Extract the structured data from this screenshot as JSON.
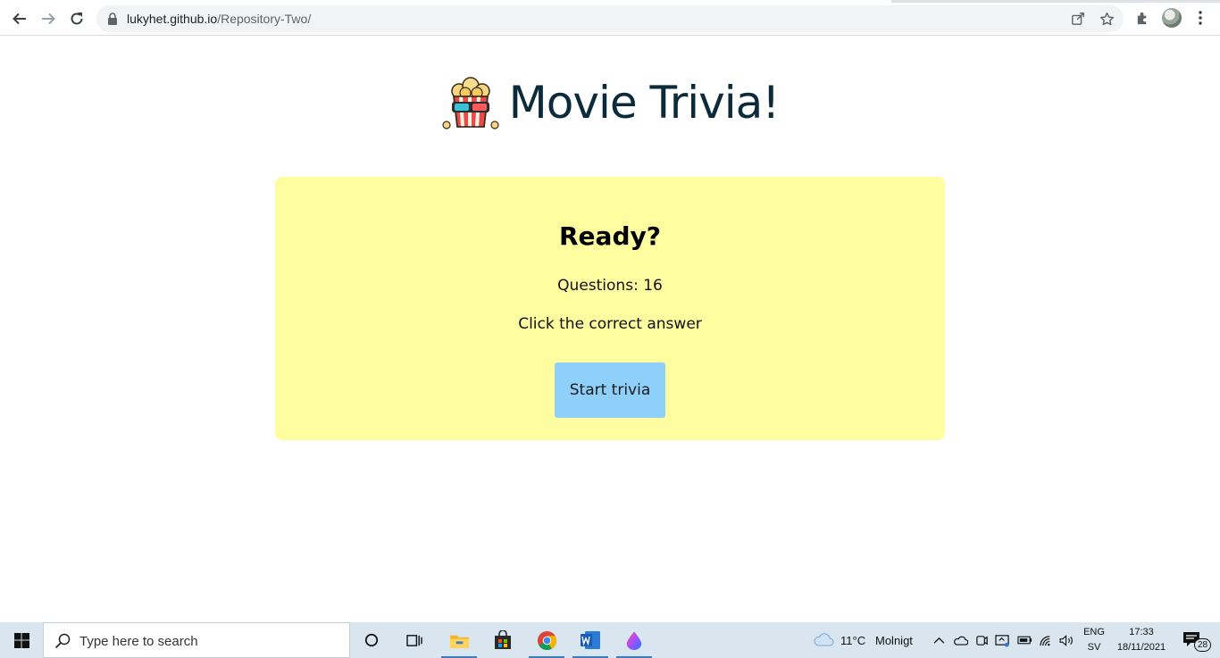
{
  "browser": {
    "url_host": "lukyhet.github.io",
    "url_path": "/Repository-Two/"
  },
  "page": {
    "title": "Movie Trivia!",
    "logo": "popcorn-3d-glasses-icon"
  },
  "card": {
    "title": "Ready?",
    "questions_text": "Questions: 16",
    "instruction": "Click the correct answer",
    "start_button": "Start trivia",
    "background": "#fefd9f",
    "button_color": "#8fd0fb"
  },
  "taskbar": {
    "search_placeholder": "Type here to search",
    "weather_temp": "11°C",
    "weather_desc": "Molnigt",
    "lang_top": "ENG",
    "lang_bottom": "SV",
    "time": "17:33",
    "date": "18/11/2021",
    "notifications": "28"
  }
}
